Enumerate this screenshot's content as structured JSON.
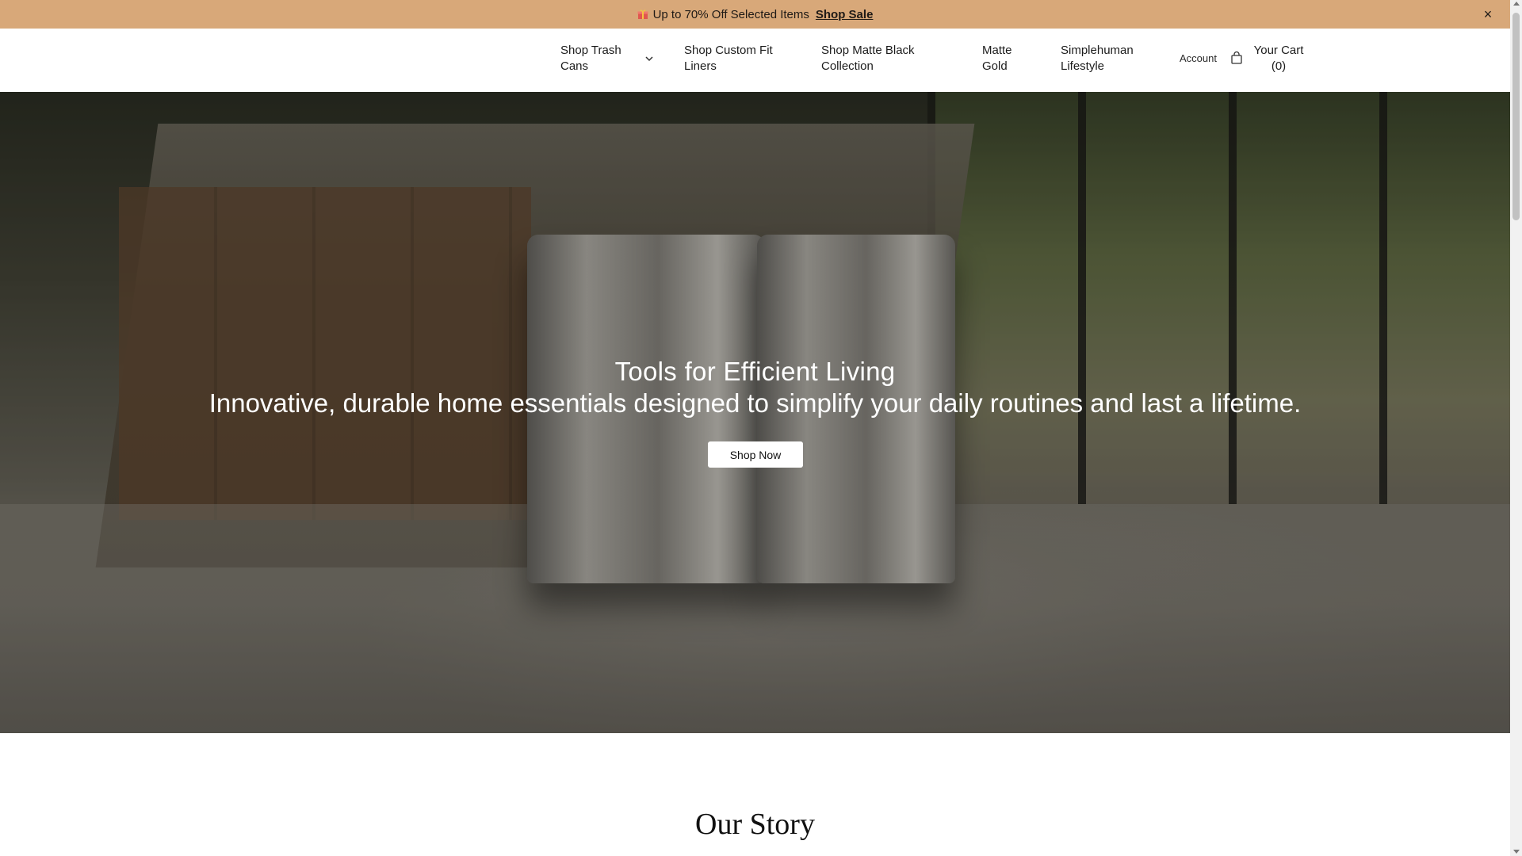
{
  "announcement": {
    "icon": "gift-icon",
    "message": "Up to 70% Off Selected Items",
    "link_label": "Shop Sale",
    "close_label": "×"
  },
  "header": {
    "nav": [
      {
        "label": "Shop Trash Cans",
        "has_dropdown": true
      },
      {
        "label": "Shop Custom Fit Liners"
      },
      {
        "label": "Shop Matte Black Collection"
      },
      {
        "label": "Matte Gold"
      },
      {
        "label": "Simplehuman Lifestyle"
      }
    ],
    "account_label": "Account",
    "cart_label": "Your Cart",
    "cart_count": "(0)"
  },
  "hero": {
    "title": "Tools for Efficient Living",
    "subtitle": "Innovative, durable home essentials designed to simplify your daily routines and last a lifetime.",
    "button_label": "Shop Now"
  },
  "story": {
    "title": "Our Story"
  },
  "colors": {
    "announcement_bg": "#d8a879",
    "header_bg": "#ffffff",
    "hero_text": "#ffffff",
    "button_bg": "#ffffff"
  }
}
